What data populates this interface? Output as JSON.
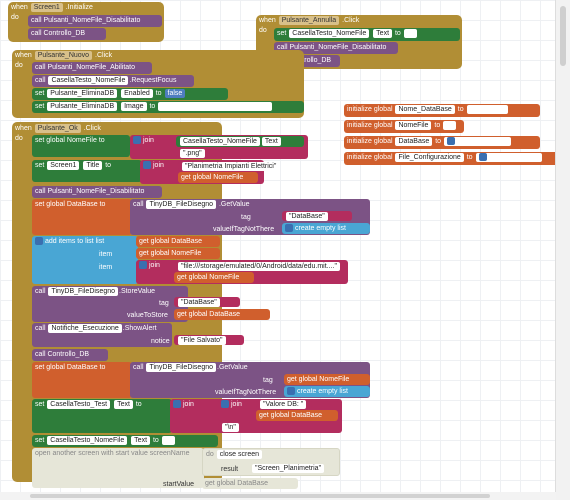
{
  "ev_screen1": {
    "when": "when",
    "component": "Screen1",
    "event": ".Initialize",
    "do": "do"
  },
  "ev_screen1_body": [
    {
      "kind": "call",
      "label": "Pulsanti_NomeFile_Disabilitato"
    },
    {
      "kind": "call",
      "label": "Controllo_DB"
    }
  ],
  "ev_annulla": {
    "when": "when",
    "component": "Pulsante_Annulla",
    "event": ".Click",
    "do": "do"
  },
  "ev_annulla_body": {
    "set_label": "set",
    "set_comp": "CasellaTesto_NomeFile",
    "set_prop": "Text",
    "to": "to",
    "value": "\"  \"",
    "call1": "Pulsanti_NomeFile_Disabilitato",
    "call2": "Controllo_DB",
    "call_word": "call"
  },
  "ev_nuovo": {
    "when": "when",
    "component": "Pulsante_Nuovo",
    "event": ".Click",
    "do": "do"
  },
  "ev_nuovo_body": {
    "call1": "Pulsanti_NomeFile_Abilitato",
    "call2_comp": "CasellaTesto_NomeFile",
    "call2_method": ".RequestFocus",
    "set1_comp": "Pulsante_EliminaDB",
    "set1_prop": "Enabled",
    "set1_value": "false",
    "set2_comp": "Pulsante_EliminaDB",
    "set2_prop": "Image",
    "set2_value": "\"button_elimina-database(off).png\""
  },
  "globals": [
    {
      "label": "initialize global",
      "name": "Nome_DataBase",
      "to": "to",
      "value": "\"DataBase\""
    },
    {
      "label": "initialize global",
      "name": "NomeFile",
      "to": "to",
      "value": "\"  \""
    },
    {
      "label": "initialize global",
      "name": "DataBase",
      "to": "to",
      "value": "create empty list"
    },
    {
      "label": "initialize global",
      "name": "File_Configurazione",
      "to": "to",
      "value": "create empty list"
    }
  ],
  "ev_ok": {
    "when": "when",
    "component": "Pulsante_Ok",
    "event": ".Click",
    "do": "do"
  },
  "ev_ok_body": {
    "set_global": "set global NomeFile",
    "to": "to",
    "join": "join",
    "casella": "CasellaTesto_NomeFile",
    "text": "Text",
    "png": "\".png\"",
    "screen": "Screen1",
    "title": "Title",
    "planim": "\"Planimetria Impianti Elettrici\"",
    "get_nomefile": "get global NomeFile",
    "call_disab": "Pulsanti_NomeFile_Disabilitato",
    "set_db": "set global DataBase",
    "call_word": "call",
    "tinydb": "TinyDB_FileDisegno",
    "getvalue": ".GetValue",
    "tag": "tag",
    "db_string": "\"DataBase\"",
    "vitnt": "valueIfTagNotThere",
    "empty_list": "create empty list",
    "add_items": "add items to list",
    "list": "list",
    "item": "item",
    "get_db": "get global DataBase",
    "file_path": "\"file:///storage/emulated/0/Android/data/edu.mit....\"",
    "storevalue": ".StoreValue",
    "valuetostore": "valueToStore",
    "notif": "Notifiche_Esecuzione",
    "showalert": ".ShowAlert",
    "notice": "notice",
    "salvato": "\"File Salvato\"",
    "call_controllo": "Controllo_DB",
    "casella_test": "CasellaTesto_Test",
    "valore_db": "\"Valore DB: \"",
    "newline": "\"\\n\"",
    "empty_str": "\"  \"",
    "open_screen": "open another screen with start value  screenName",
    "close_screen": "close screen",
    "result": "result",
    "screen_planim": "\"Screen_Planimetria\"",
    "startvalue": "startValue"
  }
}
